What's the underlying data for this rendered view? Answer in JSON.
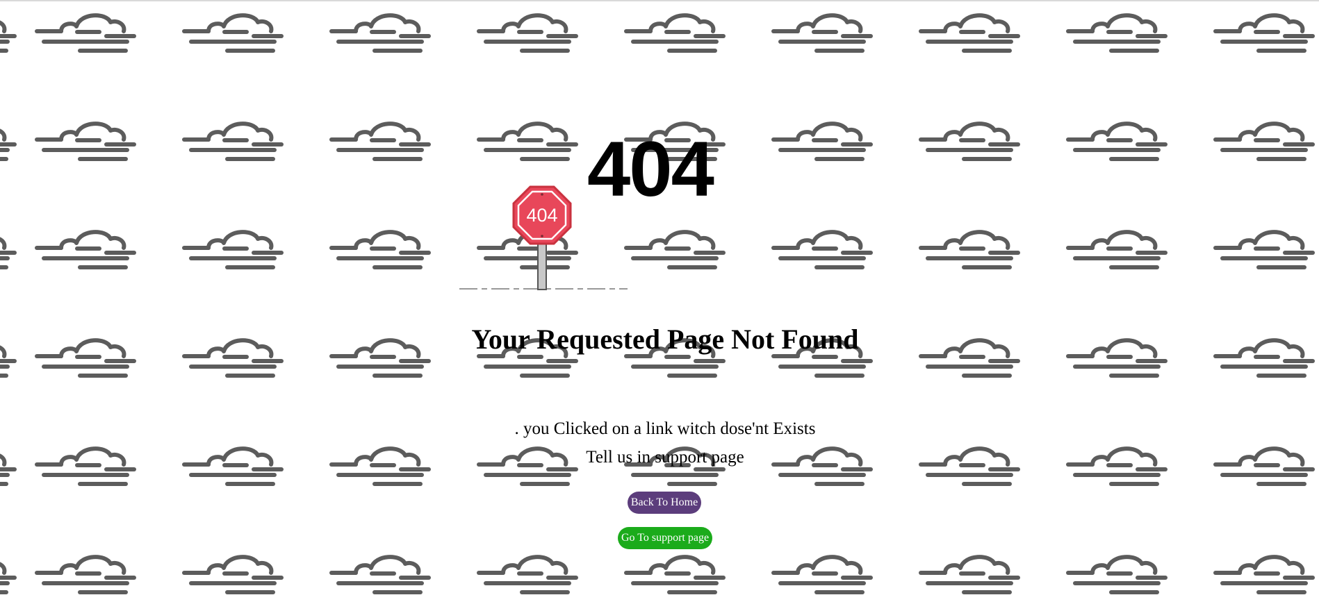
{
  "error_code": "404",
  "sign_text": "404",
  "title": "Your Requested Page Not Found",
  "message_line1": ". you Clicked on a link witch dose'nt Exists",
  "message_line2": "Tell us in support page",
  "buttons": {
    "home": "Back To Home",
    "support": "Go To support page"
  },
  "colors": {
    "home_button": "#5c3d7c",
    "support_button": "#1bab1b",
    "sign_red": "#e8475a",
    "cloud": "#5c5c5c"
  },
  "icons": {
    "background": "cloud-icon",
    "sign": "stop-sign-icon"
  }
}
